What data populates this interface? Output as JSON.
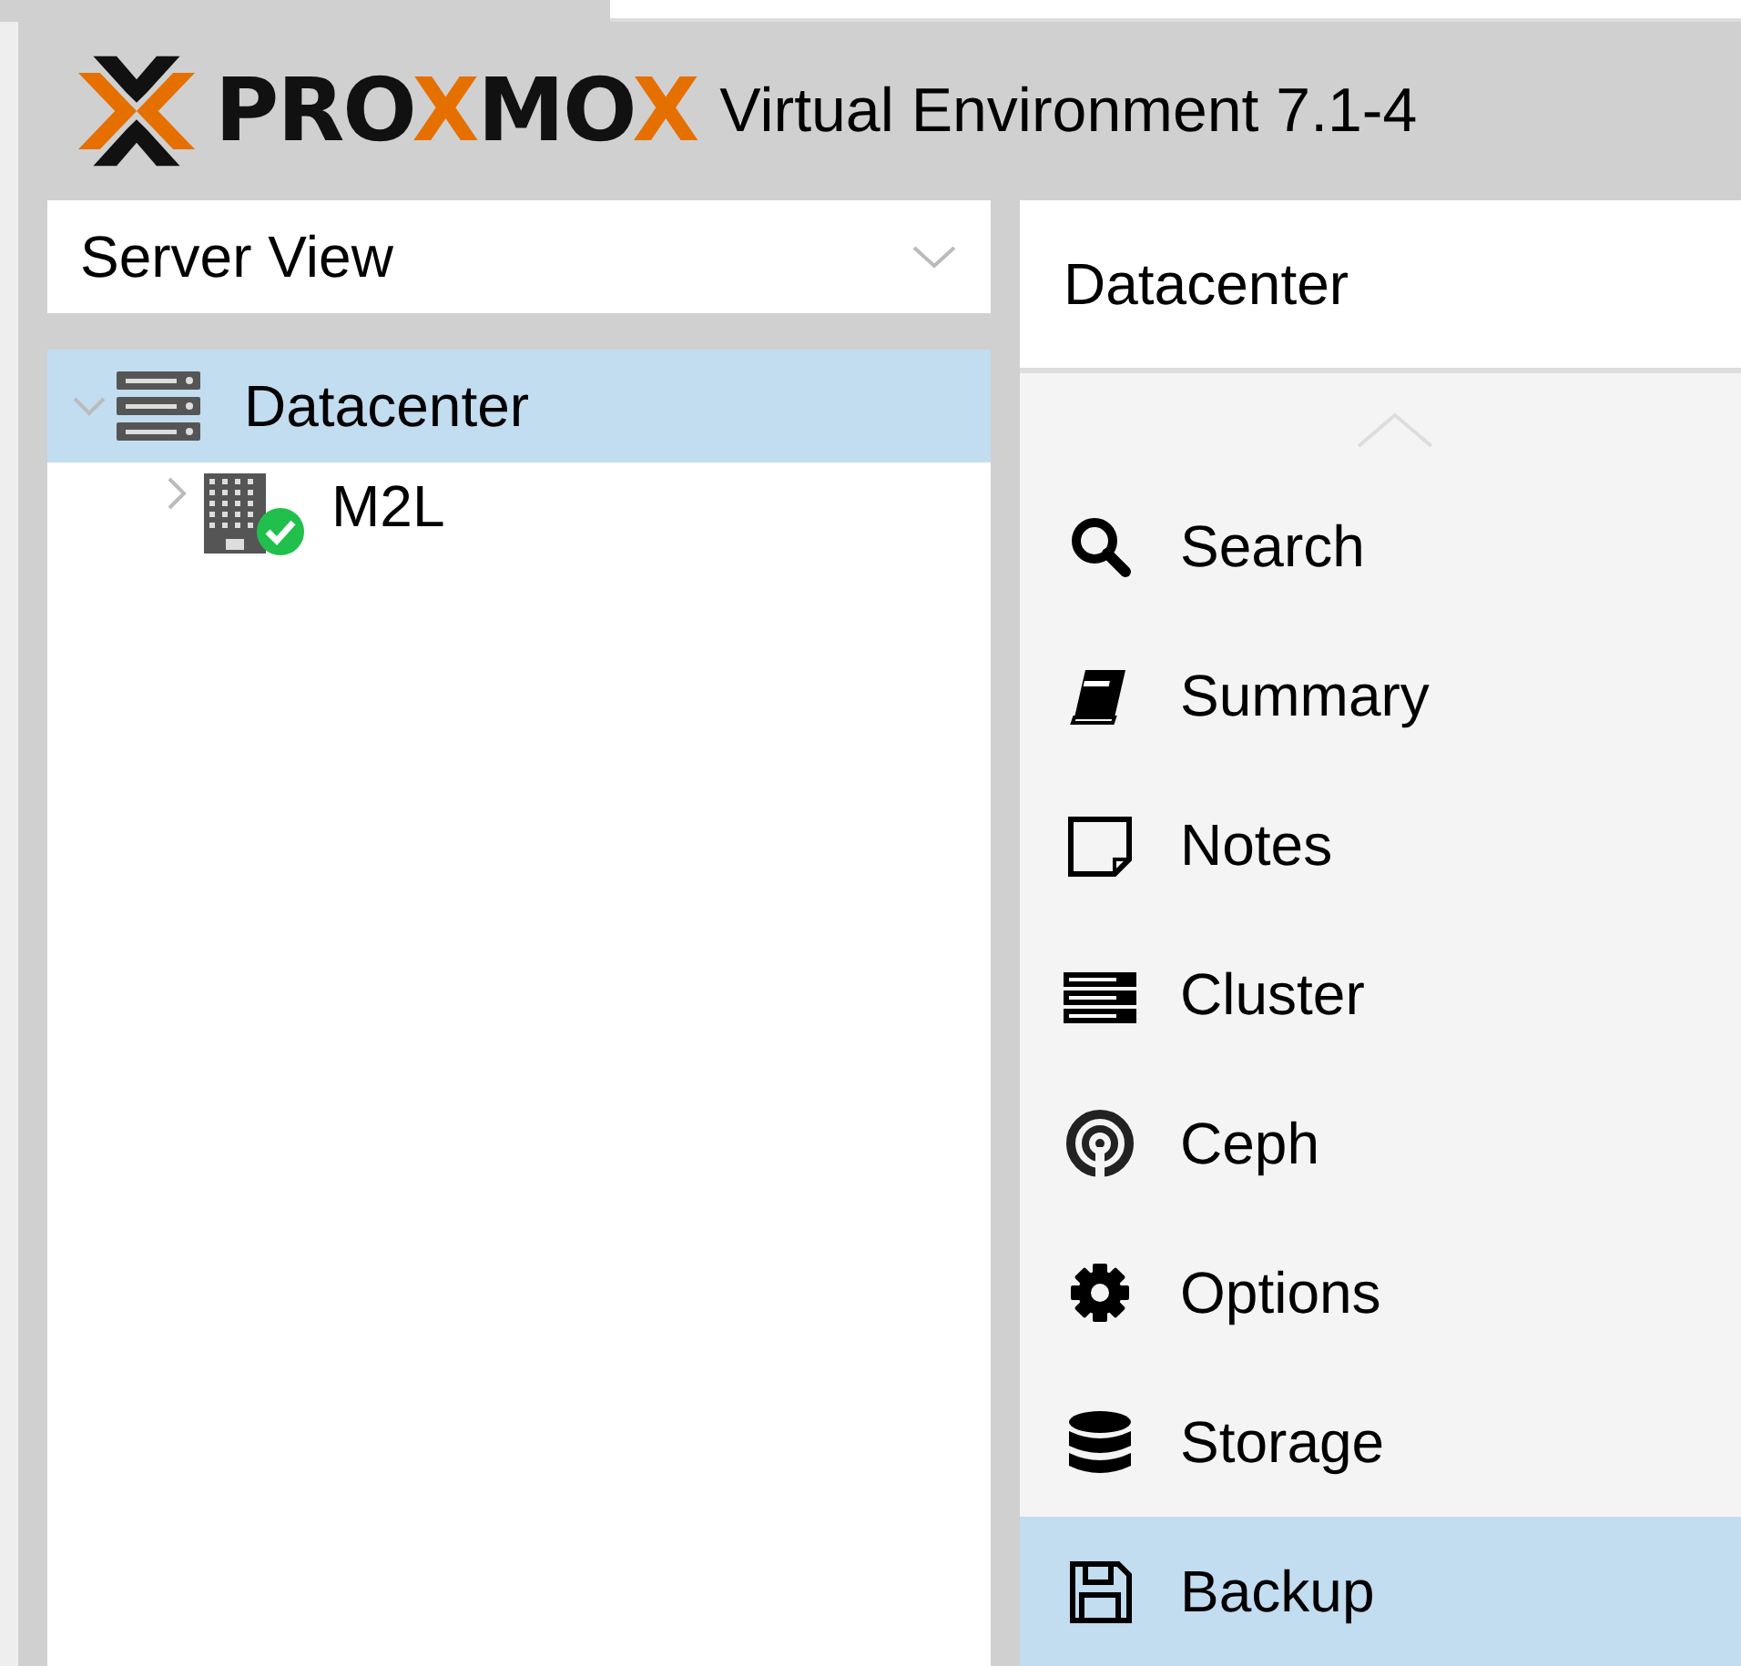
{
  "header": {
    "logo": "PROXMOX",
    "title": "Virtual Environment 7.1-4"
  },
  "view_selector": {
    "value": "Server View"
  },
  "tree": [
    {
      "label": "Datacenter",
      "selected": true,
      "expanded": true,
      "children": [
        {
          "label": "M2L",
          "selected": false,
          "expanded": false,
          "online": true
        }
      ]
    }
  ],
  "panel": {
    "title": "Datacenter"
  },
  "nav": [
    {
      "label": "Search",
      "selected": false
    },
    {
      "label": "Summary",
      "selected": false
    },
    {
      "label": "Notes",
      "selected": false
    },
    {
      "label": "Cluster",
      "selected": false
    },
    {
      "label": "Ceph",
      "selected": false
    },
    {
      "label": "Options",
      "selected": false
    },
    {
      "label": "Storage",
      "selected": false
    },
    {
      "label": "Backup",
      "selected": true
    }
  ]
}
